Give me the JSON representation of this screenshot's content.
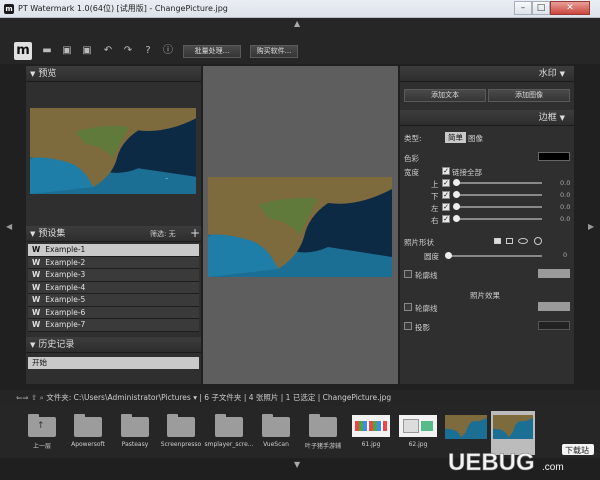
{
  "window": {
    "title": "PT Watermark 1.0(64位) [试用版] - ChangePicture.jpg"
  },
  "toolbar": {
    "logo": "m",
    "icons": [
      "folder-icon",
      "save-icon",
      "save-as-icon",
      "undo-icon",
      "redo-icon",
      "help-icon",
      "info-icon"
    ],
    "batch_label": "批量处理...",
    "buy_label": "购买软件..."
  },
  "preview_panel": {
    "title": "预览"
  },
  "presets_panel": {
    "title": "预设集",
    "filter_label": "筛选: 无",
    "add_label": "+",
    "items": [
      {
        "label": "Example-1",
        "selected": true
      },
      {
        "label": "Example-2",
        "selected": false
      },
      {
        "label": "Example-3",
        "selected": false
      },
      {
        "label": "Example-4",
        "selected": false
      },
      {
        "label": "Example-5",
        "selected": false
      },
      {
        "label": "Example-6",
        "selected": false
      },
      {
        "label": "Example-7",
        "selected": false
      }
    ]
  },
  "history_panel": {
    "title": "历史记录",
    "items": [
      "开始"
    ]
  },
  "watermark_panel": {
    "title": "水印",
    "add_text_label": "添加文本",
    "add_image_label": "添加图像"
  },
  "border_panel": {
    "title": "边框",
    "type_label": "类型:",
    "type_simple": "简单",
    "type_image": "图像",
    "color_label": "色彩",
    "color_value": "#000000",
    "width_label": "宽度",
    "link_all_label": "链接全部",
    "sides": [
      {
        "label": "上",
        "value": "0.0"
      },
      {
        "label": "下",
        "value": "0.0"
      },
      {
        "label": "左",
        "value": "0.0"
      },
      {
        "label": "右",
        "value": "0.0"
      }
    ],
    "shape_label": "照片形状",
    "roundness_label": "圆度",
    "roundness_value": "0",
    "outline_label": "轮廓线",
    "photo_effects_label": "照片效果",
    "effect_outline_label": "轮廓线",
    "shadow_label": "投影"
  },
  "pathbar": {
    "text": "文件夹: C:\\Users\\Administrator\\Pictures ▾ | 6 子文件夹 | 4 张照片 | 1 已选定 | ChangePicture.jpg"
  },
  "filmstrip": {
    "items": [
      {
        "label": "上一层",
        "kind": "up"
      },
      {
        "label": "Apowersoft",
        "kind": "folder"
      },
      {
        "label": "Pasteasy",
        "kind": "folder"
      },
      {
        "label": "Screenpresso",
        "kind": "folder"
      },
      {
        "label": "smplayer_scre...",
        "kind": "folder"
      },
      {
        "label": "VueScan",
        "kind": "folder"
      },
      {
        "label": "叶子猪手游辅",
        "kind": "folder"
      },
      {
        "label": "61.jpg",
        "kind": "image"
      },
      {
        "label": "62.jpg",
        "kind": "image"
      },
      {
        "label": "",
        "kind": "photo"
      },
      {
        "label": "",
        "kind": "photo-selected"
      }
    ]
  },
  "watermark_logo": {
    "text": "UEBUG.com",
    "badge": "下载站"
  },
  "colors": {
    "accent": "#c9c9c9",
    "panel": "#2f2f2f",
    "canvas": "#5e5e5e",
    "sea": "#1b6f95",
    "land": "#7d6a3d"
  }
}
